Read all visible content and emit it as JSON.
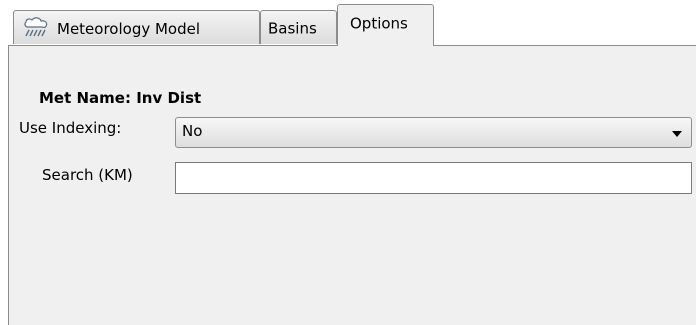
{
  "tabs": [
    {
      "label": "Meteorology Model",
      "icon": "meteorology-rain-icon",
      "selected": false
    },
    {
      "label": "Basins",
      "selected": false
    },
    {
      "label": "Options",
      "selected": true
    }
  ],
  "options": {
    "met_name_label": "Met Name:",
    "met_name_value": "Inv Dist",
    "use_indexing_label": "Use Indexing:",
    "use_indexing_value": "No",
    "search_label": "Search (KM)",
    "search_value": ""
  },
  "colors": {
    "panel_background": "#f0f0f0",
    "border": "#8c8c8c"
  }
}
